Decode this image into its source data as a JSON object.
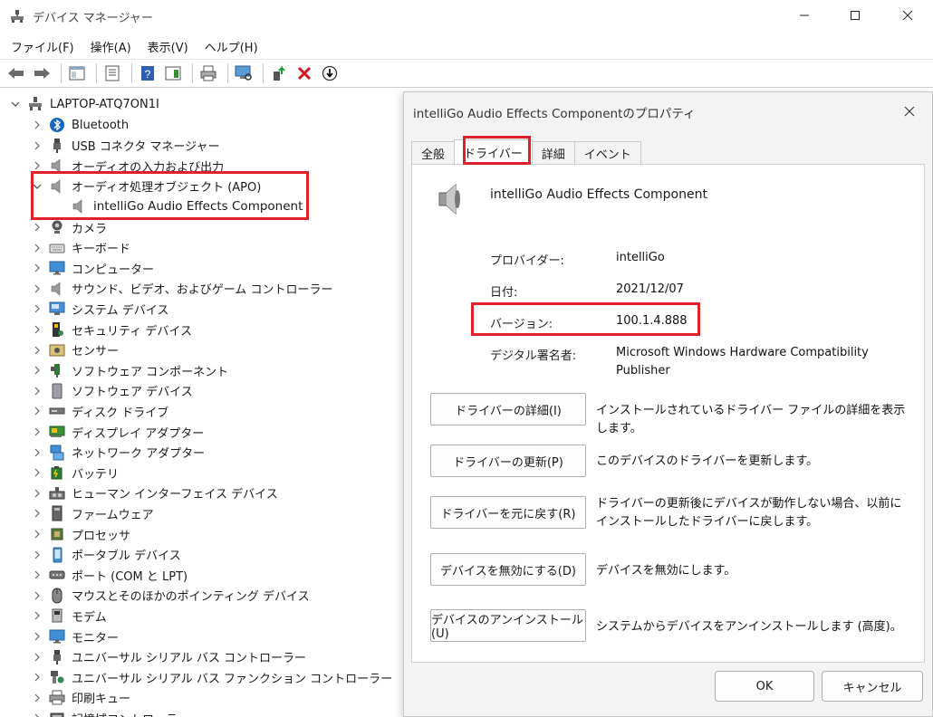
{
  "window": {
    "title": "デバイス マネージャー",
    "menu": [
      "ファイル(F)",
      "操作(A)",
      "表示(V)",
      "ヘルプ(H)"
    ]
  },
  "tree": {
    "root": "LAPTOP-ATQ7ON1I",
    "items": [
      {
        "label": "Bluetooth",
        "icon": "bluetooth-icon"
      },
      {
        "label": "USB コネクタ マネージャー",
        "icon": "usb-icon"
      },
      {
        "label": "オーディオの入力および出力",
        "icon": "speaker-icon"
      },
      {
        "label": "オーディオ処理オブジェクト (APO)",
        "icon": "speaker-icon",
        "expanded": true
      },
      {
        "label": "intelliGo Audio Effects Component",
        "icon": "speaker-icon",
        "child": true
      },
      {
        "label": "カメラ",
        "icon": "camera-icon"
      },
      {
        "label": "キーボード",
        "icon": "keyboard-icon"
      },
      {
        "label": "コンピューター",
        "icon": "monitor-icon"
      },
      {
        "label": "サウンド、ビデオ、およびゲーム コントローラー",
        "icon": "speaker-icon"
      },
      {
        "label": "システム デバイス",
        "icon": "system-icon"
      },
      {
        "label": "セキュリティ デバイス",
        "icon": "security-icon"
      },
      {
        "label": "センサー",
        "icon": "sensor-icon"
      },
      {
        "label": "ソフトウェア コンポーネント",
        "icon": "component-icon"
      },
      {
        "label": "ソフトウェア デバイス",
        "icon": "software-device-icon"
      },
      {
        "label": "ディスク ドライブ",
        "icon": "disk-icon"
      },
      {
        "label": "ディスプレイ アダプター",
        "icon": "display-adapter-icon"
      },
      {
        "label": "ネットワーク アダプター",
        "icon": "network-icon"
      },
      {
        "label": "バッテリ",
        "icon": "battery-icon"
      },
      {
        "label": "ヒューマン インターフェイス デバイス",
        "icon": "hid-icon"
      },
      {
        "label": "ファームウェア",
        "icon": "firmware-icon"
      },
      {
        "label": "プロセッサ",
        "icon": "processor-icon"
      },
      {
        "label": "ポータブル デバイス",
        "icon": "portable-icon"
      },
      {
        "label": "ポート (COM と LPT)",
        "icon": "port-icon"
      },
      {
        "label": "マウスとそのほかのポインティング デバイス",
        "icon": "mouse-icon"
      },
      {
        "label": "モデム",
        "icon": "modem-icon"
      },
      {
        "label": "モニター",
        "icon": "monitor-icon"
      },
      {
        "label": "ユニバーサル シリアル バス コントローラー",
        "icon": "usb-icon"
      },
      {
        "label": "ユニバーサル シリアル バス ファンクション コントローラー",
        "icon": "usb-function-icon"
      },
      {
        "label": "印刷キュー",
        "icon": "printer-icon"
      },
      {
        "label": "記憶域コントローラー",
        "icon": "storage-icon"
      }
    ]
  },
  "dialog": {
    "title": "intelliGo Audio Effects Componentのプロパティ",
    "tabs": [
      "全般",
      "ドライバー",
      "詳細",
      "イベント"
    ],
    "active_tab": "ドライバー",
    "device_name": "intelliGo Audio Effects Component",
    "props": {
      "provider_label": "プロバイダー:",
      "provider_value": "intelliGo",
      "date_label": "日付:",
      "date_value": "2021/12/07",
      "version_label": "バージョン:",
      "version_value": "100.1.4.888",
      "signer_label": "デジタル署名者:",
      "signer_value_1": "Microsoft Windows Hardware Compatibility",
      "signer_value_2": "Publisher"
    },
    "actions": [
      {
        "button": "ドライバーの詳細(I)",
        "desc": "インストールされているドライバー ファイルの詳細を表示します。"
      },
      {
        "button": "ドライバーの更新(P)",
        "desc": "このデバイスのドライバーを更新します。"
      },
      {
        "button": "ドライバーを元に戻す(R)",
        "desc": "ドライバーの更新後にデバイスが動作しない場合、以前にインストールしたドライバーに戻します。"
      },
      {
        "button": "デバイスを無効にする(D)",
        "desc": "デバイスを無効にします。"
      },
      {
        "button": "デバイスのアンインストール(U)",
        "desc": "システムからデバイスをアンインストールします (高度)。"
      }
    ],
    "ok": "OK",
    "cancel": "キャンセル"
  },
  "colors": {
    "highlight": "#e0202a",
    "accent": "#1e63c6"
  }
}
